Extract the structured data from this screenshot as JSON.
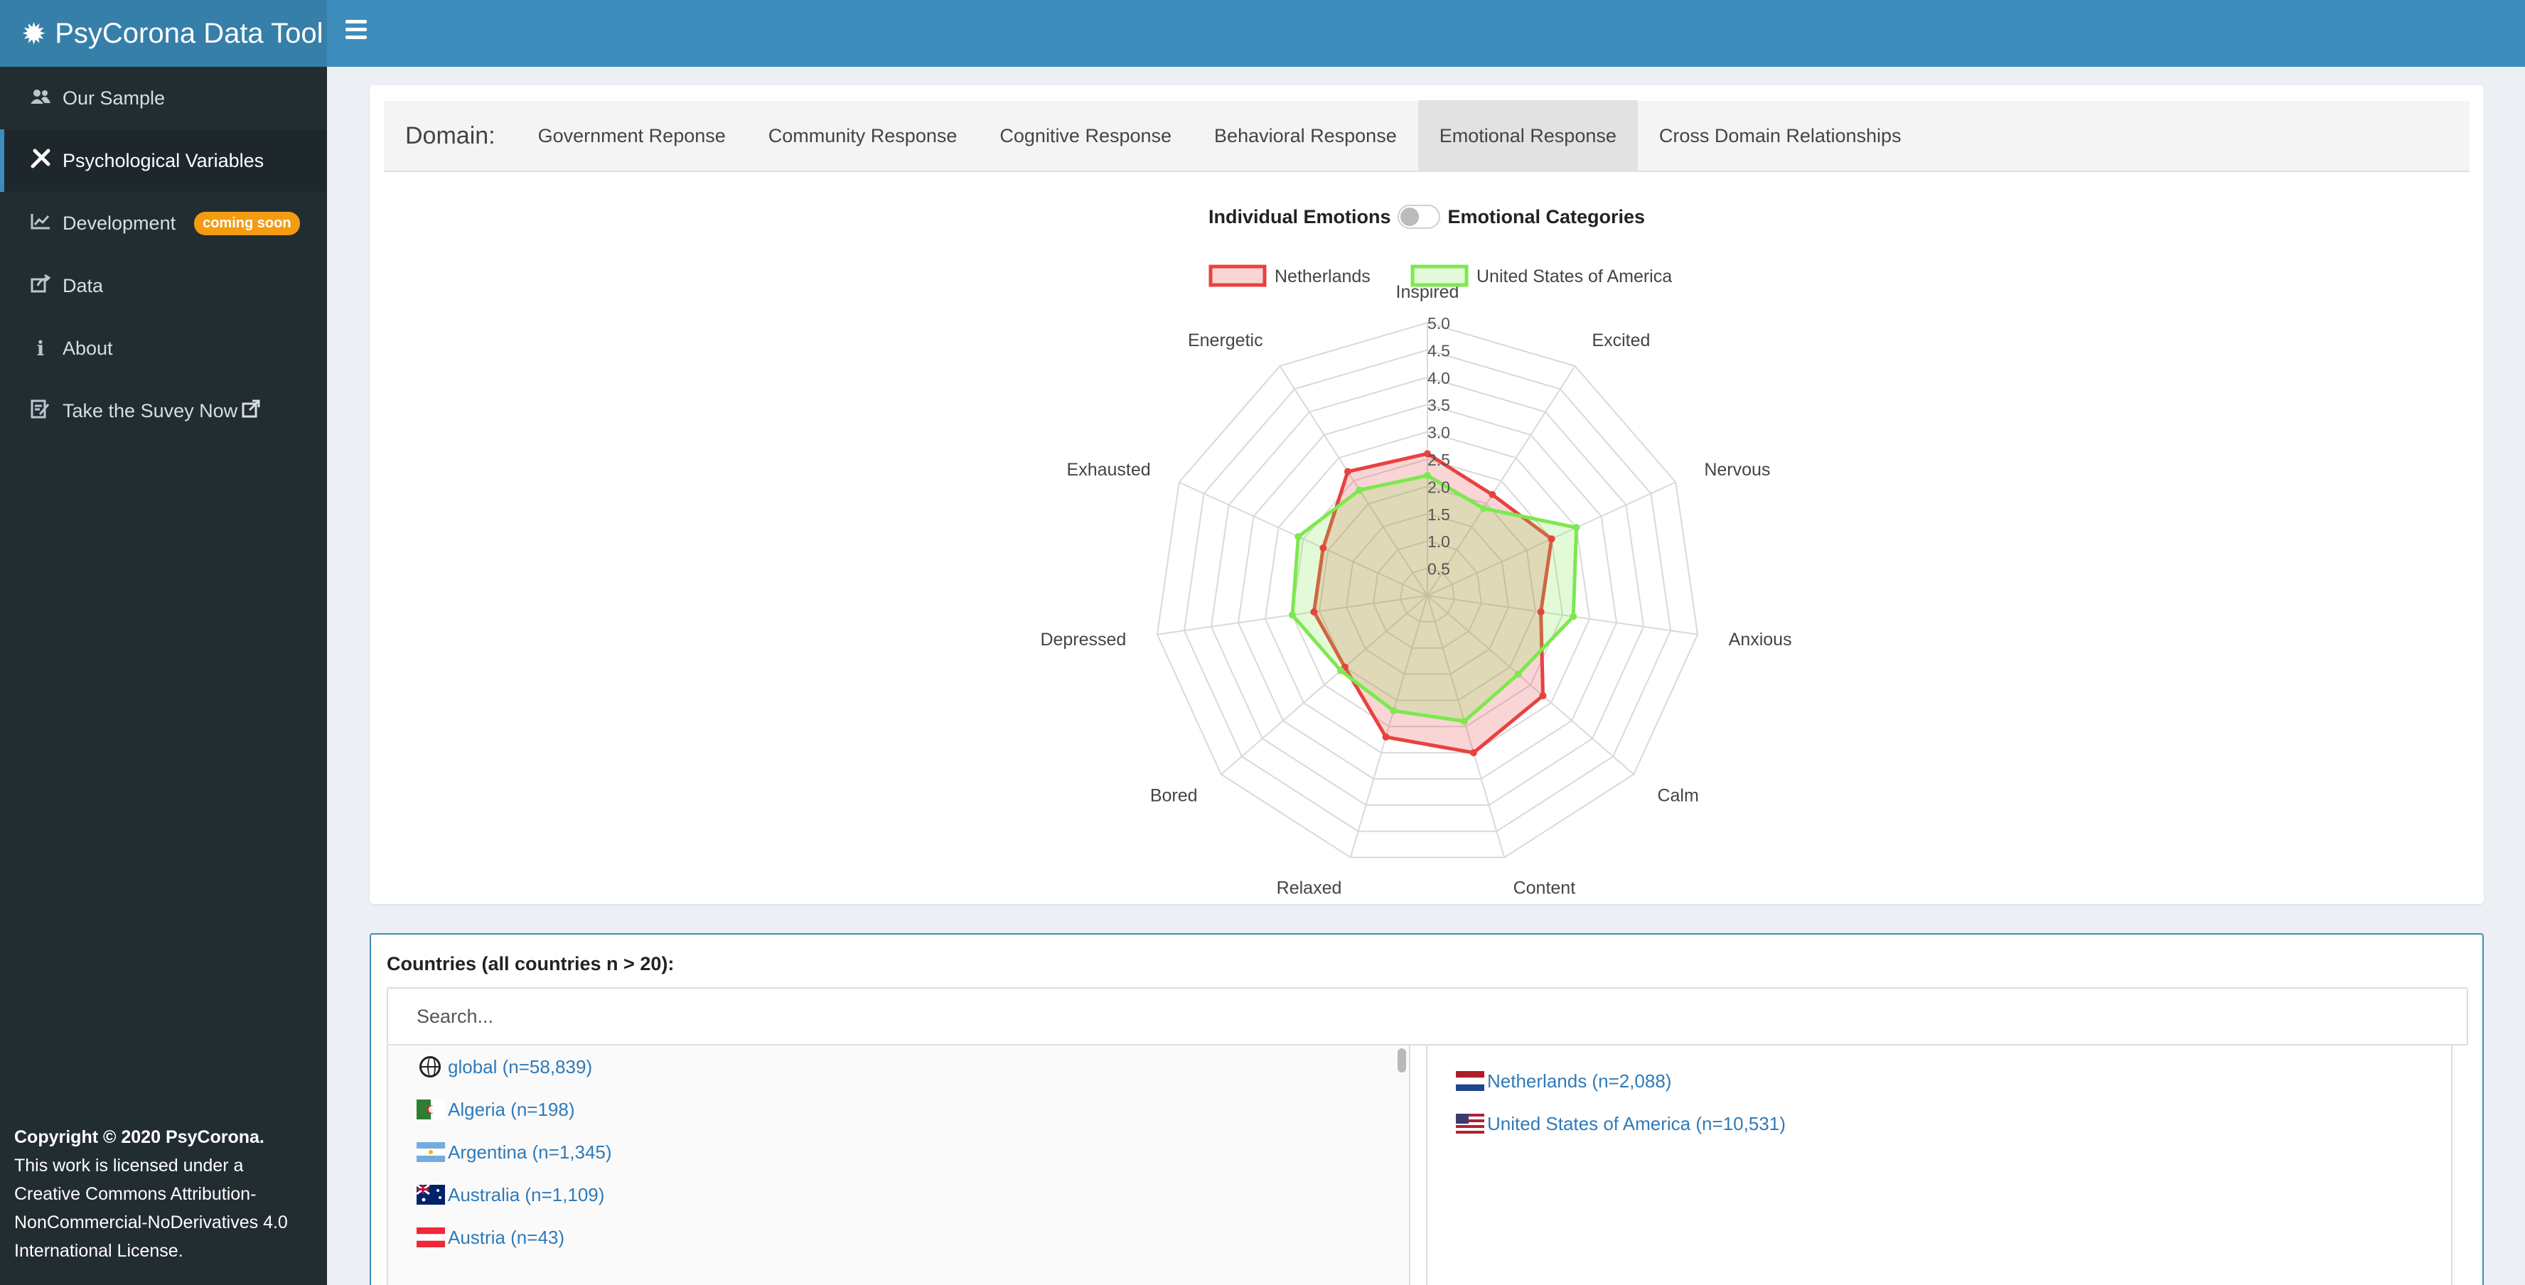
{
  "header": {
    "title": "PsyCorona Data Tool",
    "logo_icon": "gear-icon",
    "menu_icon": "hamburger-icon"
  },
  "sidebar": {
    "items": [
      {
        "label": "Our Sample",
        "icon": "users-icon",
        "active": false
      },
      {
        "label": "Psychological Variables",
        "icon": "tools-icon",
        "active": true
      },
      {
        "label": "Development",
        "icon": "chart-line-icon",
        "active": false,
        "badge": "coming soon"
      },
      {
        "label": "Data",
        "icon": "share-icon",
        "active": false
      },
      {
        "label": "About",
        "icon": "info-icon",
        "active": false
      },
      {
        "label": "Take the Suvey Now",
        "icon": "survey-icon",
        "active": false,
        "trailing_icon": "external-link-icon"
      }
    ],
    "copyright": {
      "prefix": "Copyright © 2020",
      "brand": "PsyCorona.",
      "line2": "This work is licensed under a",
      "license": "Creative Commons Attribution-NonCommercial-NoDerivatives 4.0 International License."
    }
  },
  "domain": {
    "label": "Domain:",
    "tabs": [
      {
        "label": "Government Reponse",
        "active": false
      },
      {
        "label": "Community Response",
        "active": false
      },
      {
        "label": "Cognitive Response",
        "active": false
      },
      {
        "label": "Behavioral Response",
        "active": false
      },
      {
        "label": "Emotional Response",
        "active": true
      },
      {
        "label": "Cross Domain Relationships",
        "active": false
      }
    ]
  },
  "toggle": {
    "left_label": "Individual Emotions",
    "right_label": "Emotional Categories",
    "state": "off"
  },
  "chart_data": {
    "type": "radar",
    "axes": [
      "Inspired",
      "Excited",
      "Nervous",
      "Anxious",
      "Calm",
      "Content",
      "Relaxed",
      "Bored",
      "Depressed",
      "Exhausted",
      "Energetic"
    ],
    "ticks": [
      "0.5",
      "1.0",
      "1.5",
      "2.0",
      "2.5",
      "3.0",
      "3.5",
      "4.0",
      "4.5",
      "5.0"
    ],
    "range": [
      0,
      5
    ],
    "legend": "top",
    "series": [
      {
        "name": "Netherlands",
        "color": "#e8423f",
        "fill": "rgba(232,66,63,0.22)",
        "values": [
          2.6,
          2.2,
          2.5,
          2.1,
          2.8,
          3.0,
          2.7,
          2.0,
          2.1,
          2.1,
          2.7
        ]
      },
      {
        "name": "United States of America",
        "color": "#7ee84f",
        "fill": "rgba(126,232,79,0.22)",
        "values": [
          2.2,
          1.9,
          3.0,
          2.7,
          2.2,
          2.4,
          2.2,
          2.1,
          2.5,
          2.6,
          2.3
        ]
      }
    ]
  },
  "countries": {
    "title": "Countries (all countries n > 20):",
    "search_placeholder": "Search...",
    "available": [
      {
        "label": "global (n=58,839)",
        "flag": "globe-icon"
      },
      {
        "label": "Algeria (n=198)",
        "flag": "algeria-flag-icon"
      },
      {
        "label": "Argentina (n=1,345)",
        "flag": "argentina-flag-icon"
      },
      {
        "label": "Australia (n=1,109)",
        "flag": "australia-flag-icon"
      },
      {
        "label": "Austria (n=43)",
        "flag": "austria-flag-icon"
      }
    ],
    "selected": [
      {
        "label": "Netherlands (n=2,088)",
        "flag": "netherlands-flag-icon"
      },
      {
        "label": "United States of America (n=10,531)",
        "flag": "usa-flag-icon"
      }
    ]
  }
}
